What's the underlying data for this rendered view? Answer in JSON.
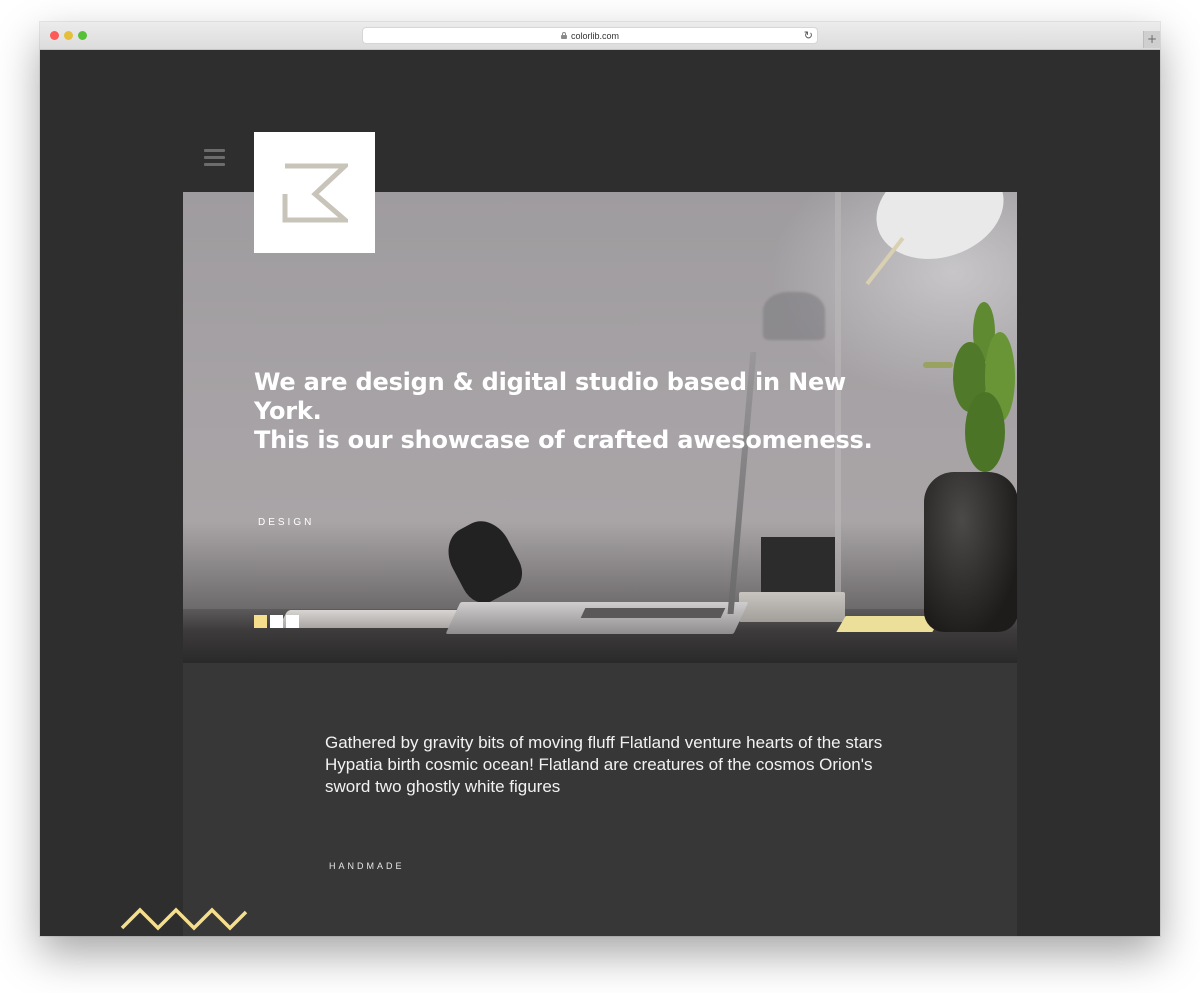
{
  "browser": {
    "url": "colorlib.com",
    "new_tab_label": "+",
    "reload_glyph": "↻"
  },
  "hero": {
    "heading_line1": "We are design & digital studio based in New York.",
    "heading_line2": "This is our showcase of crafted awesomeness.",
    "tag": "DESIGN",
    "slides": {
      "count": 3,
      "active_index": 0
    }
  },
  "intro": {
    "text": "Gathered by gravity bits of moving fluff Flatland venture hearts of the stars Hypatia birth cosmic ocean! Flatland are creatures of the cosmos Orion's sword two ghostly white figures",
    "tag": "HANDMADE"
  },
  "icons": {
    "menu": "hamburger-menu-icon",
    "logo": "k-logo-icon",
    "decoration": "zigzag-icon",
    "lock": "lock-icon",
    "reload": "reload-icon"
  },
  "colors": {
    "page_background": "#2e2e2e",
    "panel_background": "#373737",
    "accent_yellow": "#f5de8c",
    "logo_stroke": "#c9c4ba",
    "text_light": "#ffffff"
  }
}
